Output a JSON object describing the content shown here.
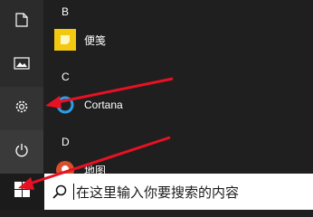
{
  "start_menu": {
    "sections": [
      {
        "letter": "B",
        "apps": [
          {
            "label": "便笺",
            "icon": "sticky-notes-icon"
          }
        ]
      },
      {
        "letter": "C",
        "apps": [
          {
            "label": "Cortana",
            "icon": "cortana-icon"
          }
        ]
      },
      {
        "letter": "D",
        "apps": [
          {
            "label": "地图",
            "icon": "maps-icon"
          }
        ]
      }
    ]
  },
  "rail": {
    "items": [
      "document-icon",
      "pictures-icon",
      "gear-icon",
      "power-icon"
    ]
  },
  "taskbar": {
    "search_placeholder": "在这里输入你要搜索的内容",
    "start_icon": "windows-logo-icon"
  },
  "annotation_color": "#e81123",
  "colors": {
    "accent": "#0078d7",
    "sticky_notes": "#f2c811",
    "cortana": "#2b9fe8",
    "maps": "#d94f2b"
  }
}
